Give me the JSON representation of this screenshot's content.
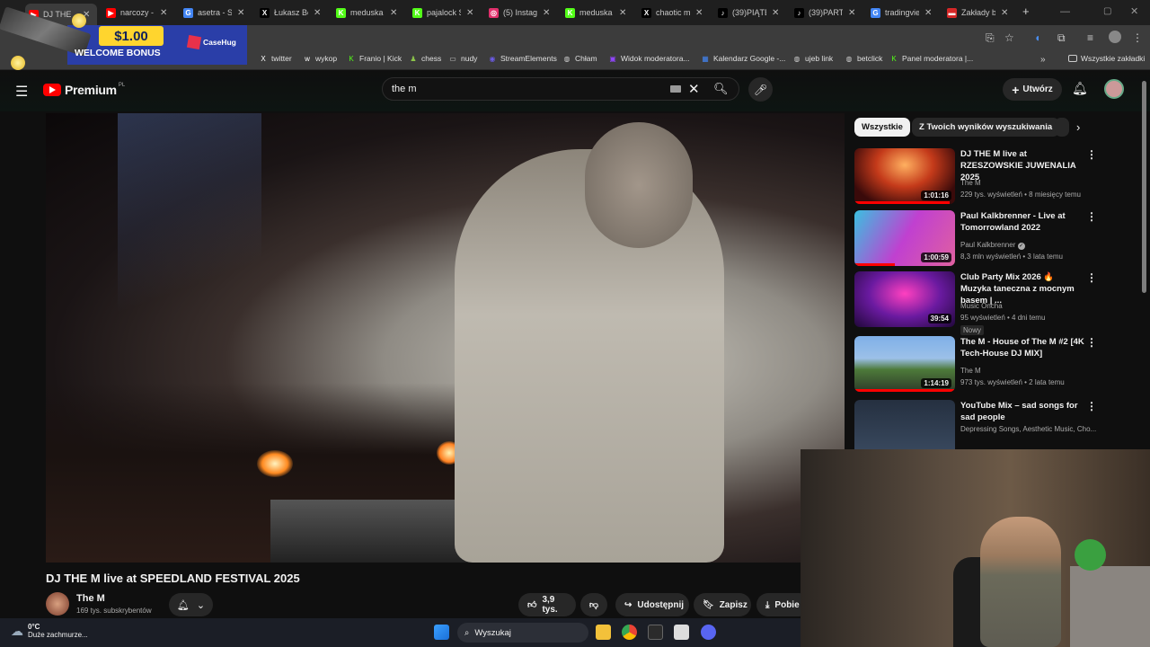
{
  "tabs": [
    {
      "title": "DJ THE",
      "fav": "youtube",
      "color": "#ff0000",
      "active": true
    },
    {
      "title": "narcozy -",
      "fav": "youtube",
      "color": "#ff0000"
    },
    {
      "title": "asetra - Sz",
      "fav": "google",
      "color": "#4285f4"
    },
    {
      "title": "Łukasz Bor",
      "fav": "x",
      "color": "#000000"
    },
    {
      "title": "meduska",
      "fav": "kick",
      "color": "#53fc18"
    },
    {
      "title": "pajalock S",
      "fav": "kick",
      "color": "#53fc18"
    },
    {
      "title": "(5) Instagr",
      "fav": "instagram",
      "color": "#e1306c"
    },
    {
      "title": "meduska",
      "fav": "kick",
      "color": "#53fc18"
    },
    {
      "title": "chaotic m",
      "fav": "x",
      "color": "#000000"
    },
    {
      "title": "(39)PIĄTE",
      "fav": "tiktok",
      "color": "#000000"
    },
    {
      "title": "(39)PART",
      "fav": "tiktok",
      "color": "#000000"
    },
    {
      "title": "tradingvie",
      "fav": "google",
      "color": "#4285f4"
    },
    {
      "title": "Zakłady b",
      "fav": "betting",
      "color": "#d62828"
    }
  ],
  "bookmarks": [
    {
      "label": "twitter",
      "icon": "x"
    },
    {
      "label": "wykop",
      "icon": "wykop"
    },
    {
      "label": "Franio | Kick",
      "icon": "kick"
    },
    {
      "label": "chess",
      "icon": "pawn"
    },
    {
      "label": "nudy",
      "icon": "folder"
    },
    {
      "label": "StreamElements",
      "icon": "se"
    },
    {
      "label": "Chłam",
      "icon": "globe"
    },
    {
      "label": "Widok moderatora...",
      "icon": "twitch"
    },
    {
      "label": "Kalendarz Google -...",
      "icon": "calendar"
    },
    {
      "label": "ujeb link",
      "icon": "globe"
    },
    {
      "label": "betclick",
      "icon": "globe"
    },
    {
      "label": "Panel moderatora |...",
      "icon": "kick"
    }
  ],
  "bookmarks_all": "Wszystkie zakładki",
  "ad": {
    "amount": "$1.00",
    "text": "WELCOME BONUS",
    "brand": "CaseHug"
  },
  "yt": {
    "brand": "Premium",
    "country": "PL",
    "search_value": "the m",
    "create_label": "Utwórz"
  },
  "video": {
    "title": "DJ THE M live at SPEEDLAND FESTIVAL 2025",
    "channel": "The M",
    "subs": "169 tys. subskrybentów",
    "likes": "3,9 tys.",
    "share": "Udostępnij",
    "save": "Zapisz",
    "download": "Pobie"
  },
  "chips": [
    "Wszystkie",
    "Z Twoich wyników wyszukiwania"
  ],
  "recs": [
    {
      "title": "DJ THE M live at RZESZOWSKIE JUWENALIA 2025",
      "channel": "The M",
      "meta": "229 tys. wyświetleń • 8 miesięcy temu",
      "duration": "1:01:16",
      "progress": 0.95,
      "verified": false,
      "badge": ""
    },
    {
      "title": "Paul Kalkbrenner - Live at Tomorrowland 2022",
      "channel": "Paul Kalkbrenner",
      "meta": "8,3 mln wyświetleń • 3 lata temu",
      "duration": "1:00:59",
      "progress": 0.4,
      "verified": true,
      "badge": ""
    },
    {
      "title": "Club Party Mix 2026 🔥 Muzyka taneczna z mocnym basem | ...",
      "channel": "Music Oncha",
      "meta": "95 wyświetleń • 4 dni temu",
      "duration": "39:54",
      "progress": 0,
      "verified": false,
      "badge": "Nowy"
    },
    {
      "title": "The M - House of The M #2 [4K Tech-House DJ MIX]",
      "channel": "The M",
      "meta": "973 tys. wyświetleń • 2 lata temu",
      "duration": "1:14:19",
      "progress": 1.0,
      "verified": false,
      "badge": ""
    },
    {
      "title": "YouTube Mix – sad songs for sad people",
      "channel": "Depressing Songs, Aesthetic Music, Cho...",
      "meta": "",
      "duration": "",
      "progress": 0,
      "verified": false,
      "badge": ""
    }
  ],
  "taskbar": {
    "temp": "0°C",
    "weather": "Duże zachmurze...",
    "search": "Wyszukaj"
  }
}
